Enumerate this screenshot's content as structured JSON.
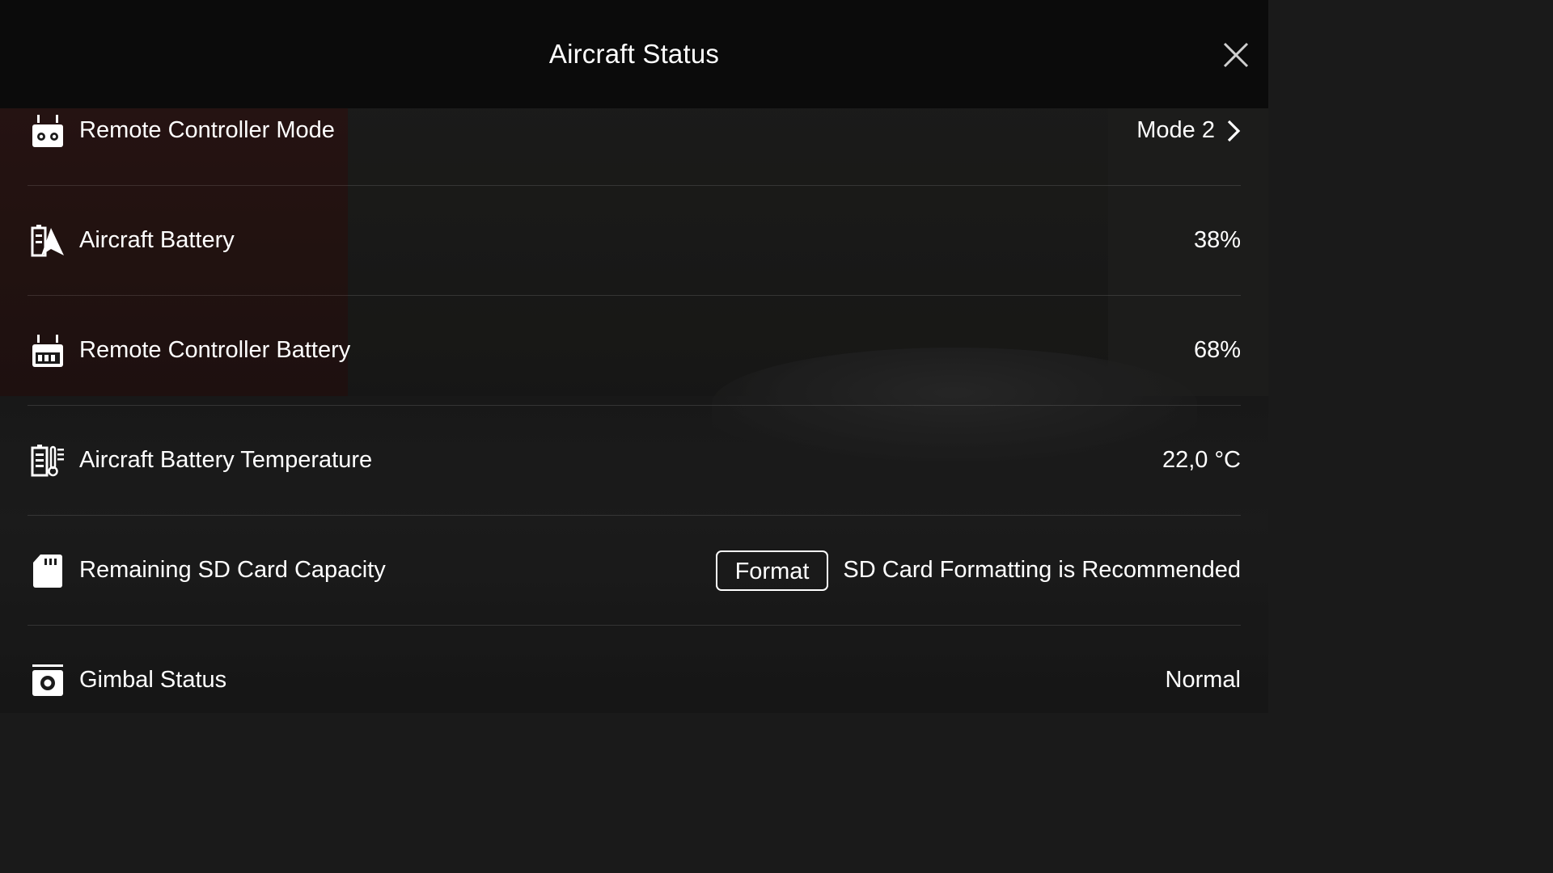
{
  "header": {
    "title": "Aircraft Status"
  },
  "rows": [
    {
      "label": "Remote Controller Mode",
      "value": "Mode 2",
      "icon": "remote-controller-icon"
    },
    {
      "label": "Aircraft Battery",
      "value": "38%",
      "icon": "aircraft-battery-icon"
    },
    {
      "label": "Remote Controller Battery",
      "value": "68%",
      "icon": "rc-battery-icon"
    },
    {
      "label": "Aircraft Battery Temperature",
      "value": "22,0 °C",
      "icon": "battery-temperature-icon"
    },
    {
      "label": "Remaining SD Card Capacity",
      "value": "SD Card Formatting is Recommended",
      "button": "Format",
      "icon": "sd-card-icon"
    },
    {
      "label": "Gimbal Status",
      "value": "Normal",
      "icon": "gimbal-camera-icon"
    }
  ]
}
